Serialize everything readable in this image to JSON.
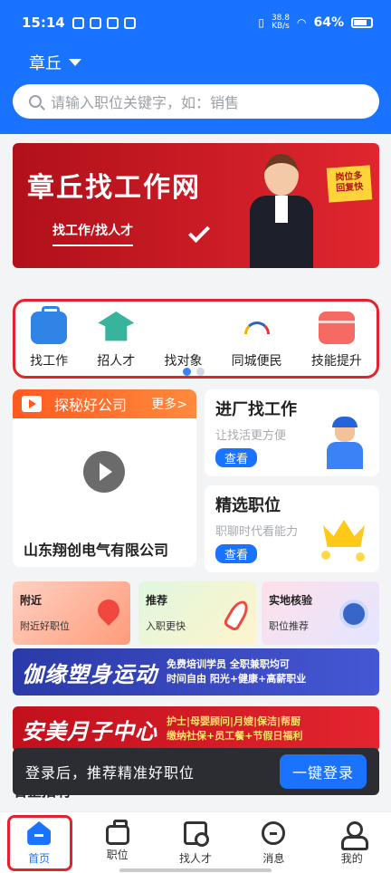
{
  "status_bar": {
    "time": "15:14",
    "net_speed": "38.8\nKB/s",
    "battery": "64%"
  },
  "location": {
    "city": "章丘"
  },
  "search": {
    "placeholder": "请输入职位关键字，如：销售"
  },
  "banner": {
    "title": "章丘找工作网",
    "subtitle": "找工作/找人才",
    "tag": "岗位多\n回复快"
  },
  "categories": [
    {
      "label": "找工作",
      "icon": "briefcase-icon"
    },
    {
      "label": "招人才",
      "icon": "graduation-cap-icon"
    },
    {
      "label": "找对象",
      "icon": "dating-logo-icon"
    },
    {
      "label": "同城便民",
      "icon": "city-service-icon"
    },
    {
      "label": "技能提升",
      "icon": "skill-icon"
    }
  ],
  "featured_company": {
    "header": "探秘好公司",
    "more": "更多>",
    "name": "山东翔创电气有限公司"
  },
  "right_cards": [
    {
      "title": "进厂找工作",
      "sub": "让找活更方便",
      "btn": "查看"
    },
    {
      "title": "精选职位",
      "sub": "职聊时代看能力",
      "btn": "查看"
    }
  ],
  "mini_cards": [
    {
      "title": "附近",
      "sub": "附近好职位"
    },
    {
      "title": "推荐",
      "sub": "入职更快"
    },
    {
      "title": "实地核验",
      "sub": "职位推荐"
    }
  ],
  "ads": [
    {
      "big": "伽缘塑身运动",
      "small1": "免费培训学员  全职兼职均可",
      "small2": "时间自由 阳光+健康+高薪职业"
    },
    {
      "big": "安美月子中心",
      "small1": "护士|母婴顾问|月嫂|保洁|帮厨",
      "small2": "缴纳社保+员工餐+节假日福利"
    }
  ],
  "login_prompt": {
    "text": "登录后，推荐精准好职位",
    "button": "一键登录"
  },
  "section_title": "名企招聘",
  "nav": [
    {
      "label": "首页",
      "active": true
    },
    {
      "label": "职位"
    },
    {
      "label": "找人才"
    },
    {
      "label": "消息"
    },
    {
      "label": "我的"
    }
  ],
  "colors": {
    "primary": "#1a73ff",
    "accent_red": "#e1232e"
  }
}
